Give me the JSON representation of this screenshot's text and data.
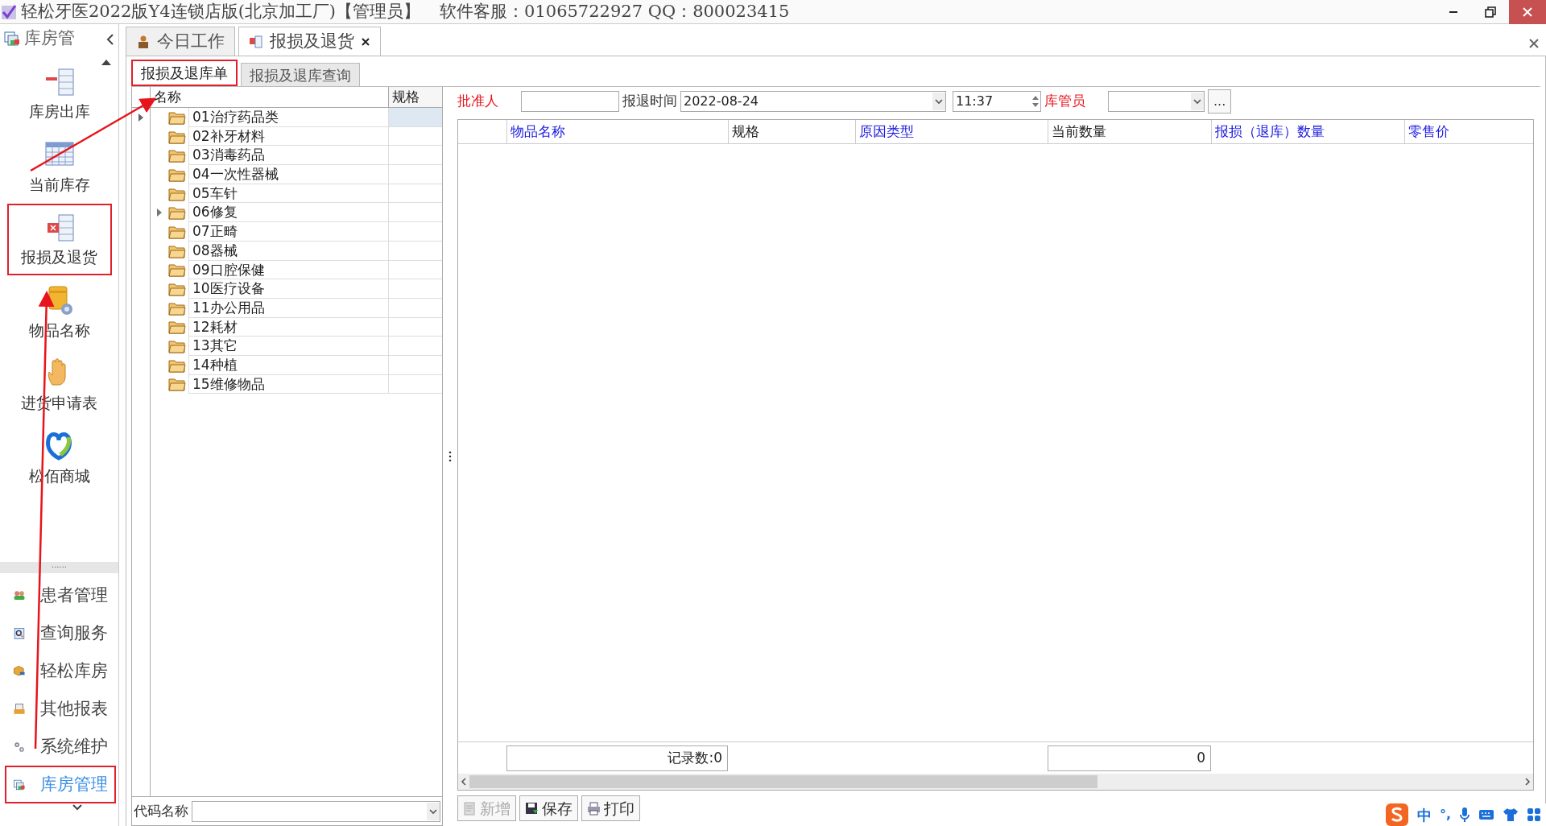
{
  "window": {
    "title": "轻松牙医2022版Y4连锁店版(北京加工厂)【管理员】",
    "support": "软件客服：01065722927 QQ：800023415"
  },
  "sidebar": {
    "header": "库房管",
    "items": [
      {
        "label": "库房出库",
        "highlighted": false
      },
      {
        "label": "当前库存",
        "highlighted": false
      },
      {
        "label": "报损及退货",
        "highlighted": true
      },
      {
        "label": "物品名称",
        "highlighted": false
      },
      {
        "label": "进货申请表",
        "highlighted": false
      },
      {
        "label": "松佰商城",
        "highlighted": false
      }
    ],
    "grip": "......",
    "sections": [
      {
        "label": "患者管理",
        "selected": false,
        "highlighted": false
      },
      {
        "label": "查询服务",
        "selected": false,
        "highlighted": false
      },
      {
        "label": "轻松库房",
        "selected": false,
        "highlighted": false
      },
      {
        "label": "其他报表",
        "selected": false,
        "highlighted": false
      },
      {
        "label": "系统维护",
        "selected": false,
        "highlighted": false
      },
      {
        "label": "库房管理",
        "selected": true,
        "highlighted": true
      }
    ]
  },
  "tabs": [
    {
      "label": "今日工作",
      "selected": false,
      "closable": false
    },
    {
      "label": "报损及退货",
      "selected": true,
      "closable": true
    }
  ],
  "subtabs": [
    {
      "label": "报损及退库单",
      "selected": true,
      "highlighted": true
    },
    {
      "label": "报损及退库查询",
      "selected": false,
      "highlighted": false
    }
  ],
  "tree": {
    "columns": [
      "名称",
      "规格"
    ],
    "rows": [
      {
        "label": "01治疗药品类",
        "current": true,
        "expandable": false
      },
      {
        "label": "02补牙材料",
        "current": false,
        "expandable": false
      },
      {
        "label": "03消毒药品",
        "current": false,
        "expandable": false
      },
      {
        "label": "04一次性器械",
        "current": false,
        "expandable": false
      },
      {
        "label": "05车针",
        "current": false,
        "expandable": false
      },
      {
        "label": "06修复",
        "current": false,
        "expandable": true
      },
      {
        "label": "07正畸",
        "current": false,
        "expandable": false
      },
      {
        "label": "08器械",
        "current": false,
        "expandable": false
      },
      {
        "label": "09口腔保健",
        "current": false,
        "expandable": false
      },
      {
        "label": "10医疗设备",
        "current": false,
        "expandable": false
      },
      {
        "label": "11办公用品",
        "current": false,
        "expandable": false
      },
      {
        "label": "12耗材",
        "current": false,
        "expandable": false
      },
      {
        "label": "13其它",
        "current": false,
        "expandable": false
      },
      {
        "label": "14种植",
        "current": false,
        "expandable": false
      },
      {
        "label": "15维修物品",
        "current": false,
        "expandable": false
      }
    ],
    "filter": {
      "label": "代码名称"
    }
  },
  "form": {
    "approver": {
      "label": "批准人",
      "required": true
    },
    "date": {
      "label": "报退时间",
      "value": "2022-08-24",
      "required": false
    },
    "time": {
      "value": "11:37"
    },
    "keeper": {
      "label": "库管员",
      "required": true
    },
    "more_button": "..."
  },
  "grid": {
    "columns": [
      {
        "label": "物品名称",
        "editable": true
      },
      {
        "label": "规格",
        "editable": false
      },
      {
        "label": "原因类型",
        "editable": true
      },
      {
        "label": "当前数量",
        "editable": false
      },
      {
        "label": "报损（退库）数量",
        "editable": true
      },
      {
        "label": "零售价",
        "editable": true
      }
    ],
    "record_count": "记录数:0",
    "total": "0"
  },
  "buttons": [
    {
      "label": "新增",
      "disabled": true
    },
    {
      "label": "保存",
      "disabled": false
    },
    {
      "label": "打印",
      "disabled": false
    }
  ],
  "ime": {
    "mode": "中",
    "punct": "°,"
  }
}
